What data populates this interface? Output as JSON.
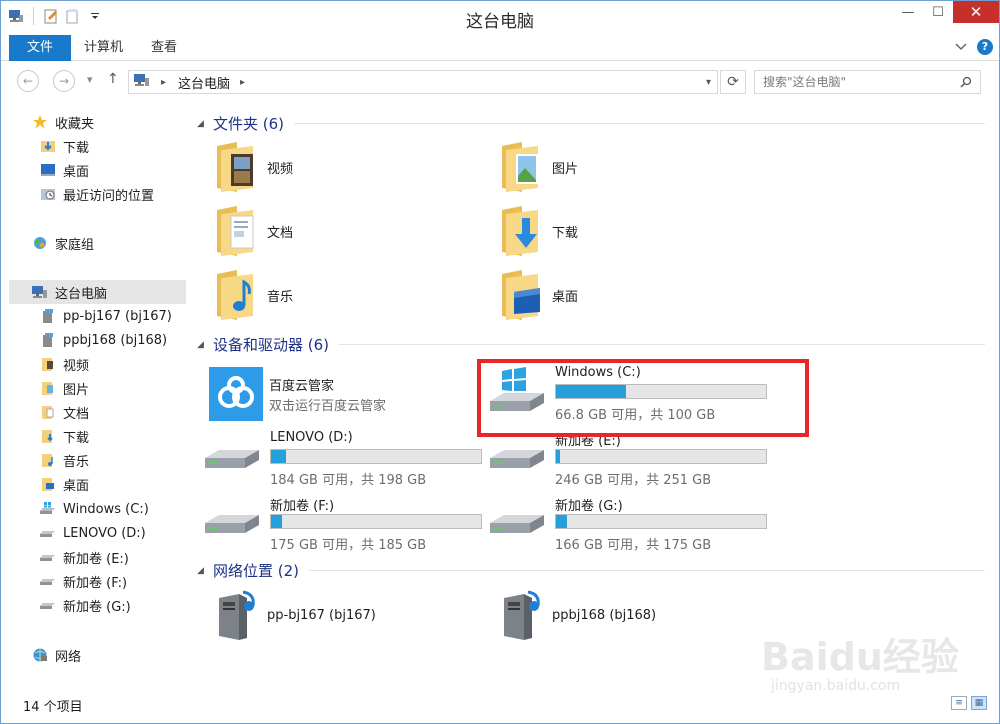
{
  "window": {
    "title": "这台电脑",
    "minimize": "—",
    "maximize": "☐",
    "close": "✕"
  },
  "ribbon": {
    "tabs": [
      "文件",
      "计算机",
      "查看"
    ]
  },
  "address": {
    "breadcrumb": "这台电脑",
    "search_placeholder": "搜索\"这台电脑\""
  },
  "sidebar": {
    "favorites": {
      "label": "收藏夹",
      "items": [
        "下载",
        "桌面",
        "最近访问的位置"
      ]
    },
    "homegroup": "家庭组",
    "this_pc": {
      "label": "这台电脑",
      "items": [
        "pp-bj167 (bj167)",
        "ppbj168 (bj168)",
        "视频",
        "图片",
        "文档",
        "下载",
        "音乐",
        "桌面",
        "Windows (C:)",
        "LENOVO (D:)",
        "新加卷 (E:)",
        "新加卷 (F:)",
        "新加卷 (G:)"
      ]
    },
    "network": "网络"
  },
  "main": {
    "folders_header": "文件夹 (6)",
    "folders": [
      "视频",
      "图片",
      "文档",
      "下载",
      "音乐",
      "桌面"
    ],
    "devices_header": "设备和驱动器 (6)",
    "app": {
      "name": "百度云管家",
      "sub": "双击运行百度云管家"
    },
    "drives": [
      {
        "name": "Windows (C:)",
        "size": "66.8 GB 可用，共 100 GB",
        "used_fraction": 0.332
      },
      {
        "name": "LENOVO (D:)",
        "size": "184 GB 可用，共 198 GB",
        "used_fraction": 0.071
      },
      {
        "name": "新加卷 (E:)",
        "size": "246 GB 可用，共 251 GB",
        "used_fraction": 0.02
      },
      {
        "name": "新加卷 (F:)",
        "size": "175 GB 可用，共 185 GB",
        "used_fraction": 0.054
      },
      {
        "name": "新加卷 (G:)",
        "size": "166 GB 可用，共 175 GB",
        "used_fraction": 0.051
      }
    ],
    "network_header": "网络位置 (2)",
    "network_items": [
      "pp-bj167 (bj167)",
      "ppbj168 (bj168)"
    ]
  },
  "status": {
    "count": "14 个项目"
  },
  "watermark": {
    "brand": "Baidu经验",
    "url": "jingyan.baidu.com"
  },
  "colors": {
    "accent": "#1979ca",
    "bar_fill": "#26a0da",
    "highlight": "#e8262a"
  }
}
